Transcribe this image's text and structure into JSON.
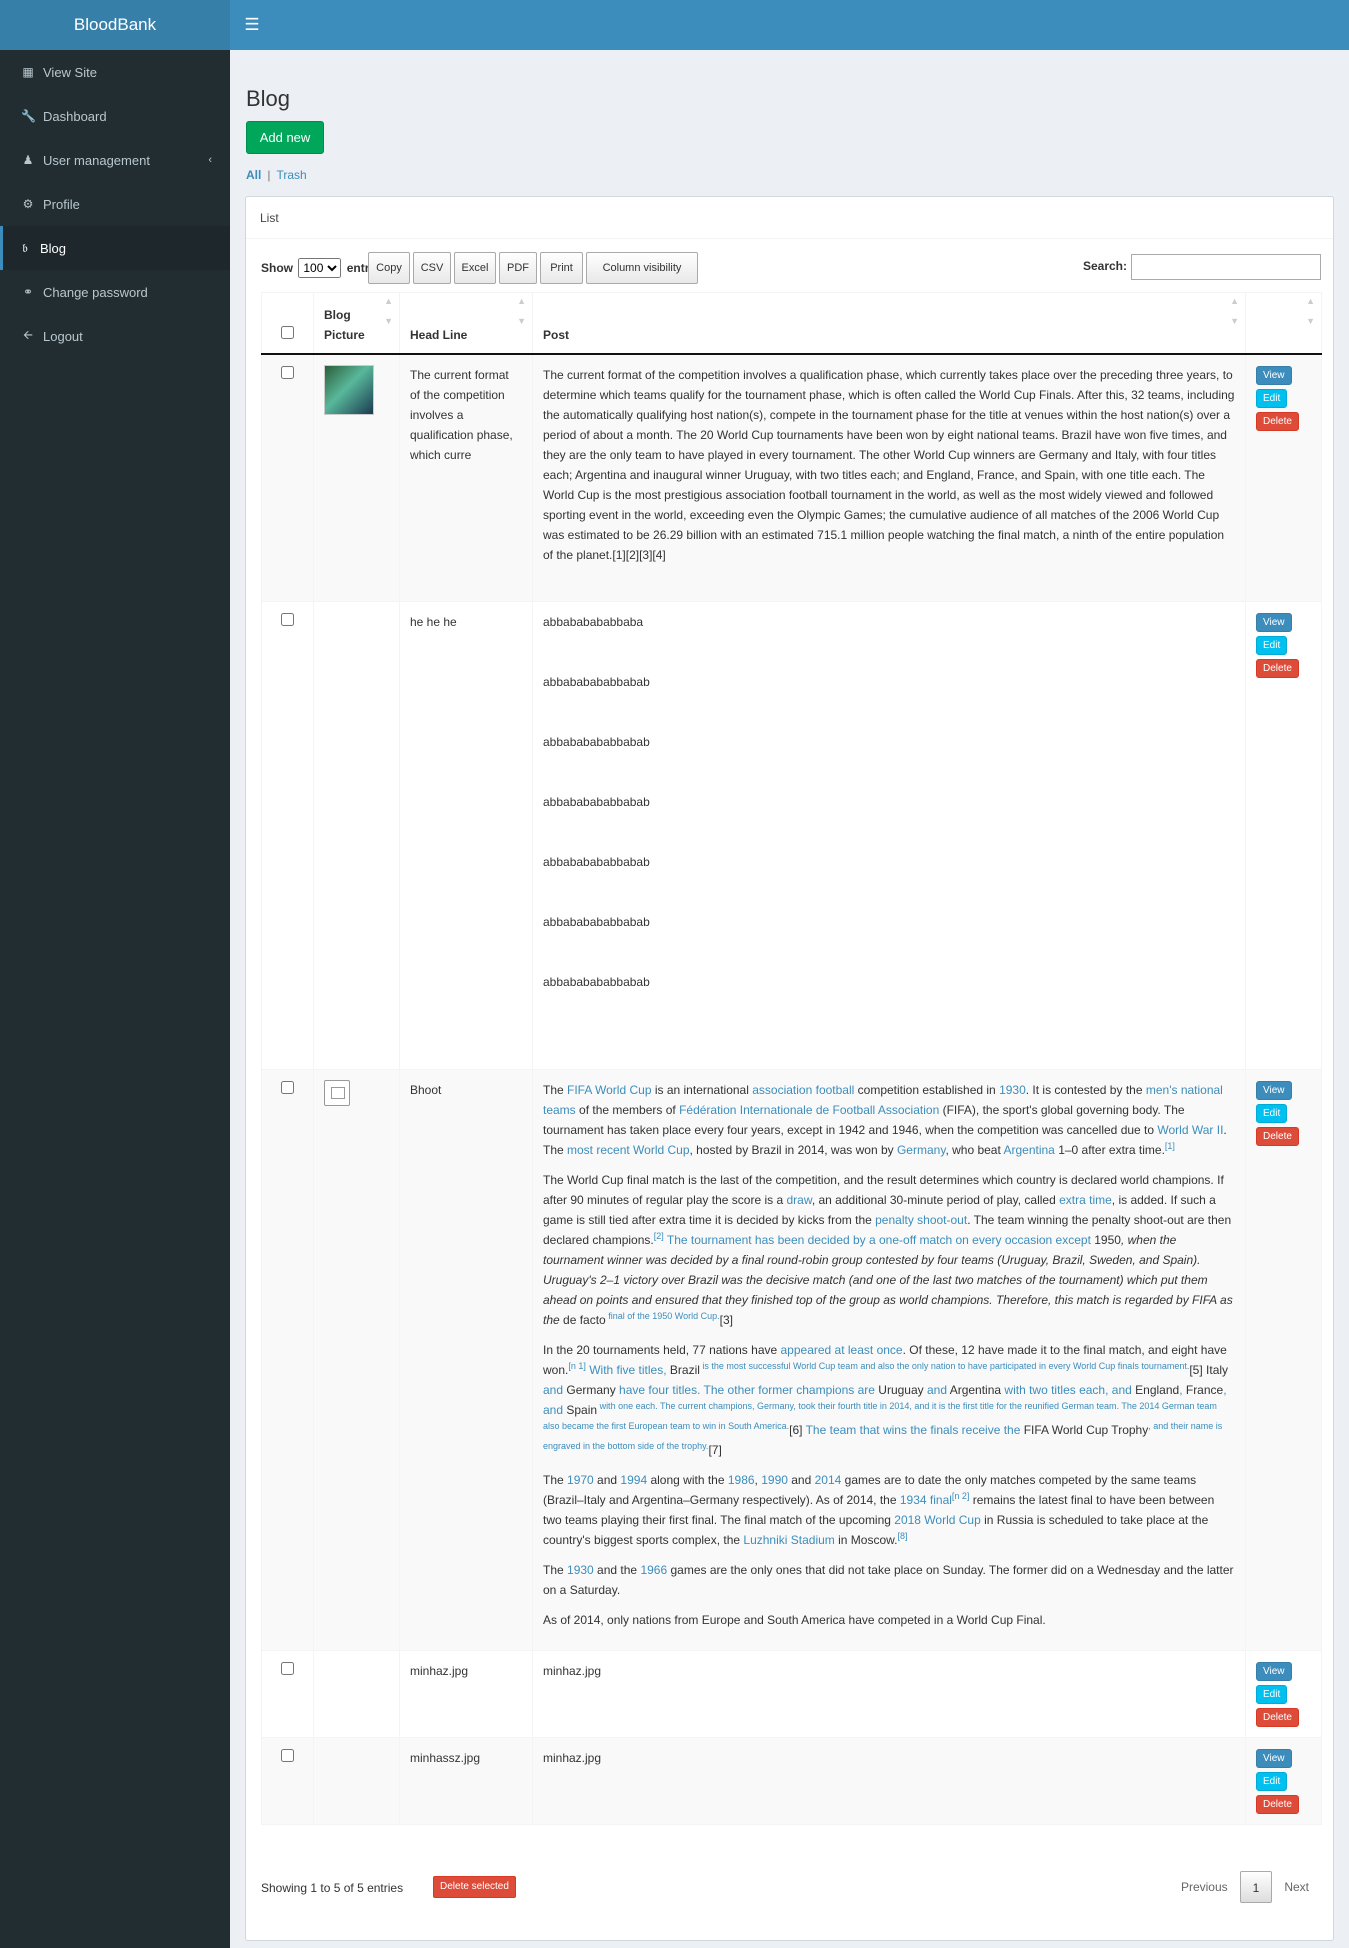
{
  "app": {
    "logo": "BloodBank",
    "toggle_icon": "bars-icon"
  },
  "sidebar": {
    "items": [
      {
        "label": "View Site",
        "icon": "th-icon"
      },
      {
        "label": "Dashboard",
        "icon": "wrench-icon"
      },
      {
        "label": "User management",
        "icon": "users-icon",
        "chevron": "chevron-left-icon"
      },
      {
        "label": "Profile",
        "icon": "cogs-icon"
      },
      {
        "label": "Blog",
        "icon": "text-icon",
        "active": true
      },
      {
        "label": "Change password",
        "icon": "key-icon"
      },
      {
        "label": "Logout",
        "icon": "arrow-left-icon"
      }
    ]
  },
  "page": {
    "title": "Blog",
    "add_button": "Add new",
    "filter_all": "All",
    "filter_sep": "|",
    "filter_trash": "Trash"
  },
  "box": {
    "title": "List"
  },
  "toolbar": {
    "show_label": "Show",
    "entries_value": "100",
    "entries_label": "entries",
    "buttons": [
      "Copy",
      "CSV",
      "Excel",
      "PDF",
      "Print",
      "Column visibility"
    ],
    "search_label": "Search:"
  },
  "table": {
    "headers": [
      "Blog Picture",
      "Head Line",
      "Post"
    ],
    "actions": {
      "view": "View",
      "edit": "Edit",
      "delete": "Delete"
    },
    "rows": [
      {
        "headline": "The current format of the competition involves a qualification phase, which curre",
        "post_plain": "The current format of the competition involves a qualification phase, which currently takes place over the preceding three years, to determine which teams qualify for the tournament phase, which is often called the World Cup Finals. After this, 32 teams, including the automatically qualifying host nation(s), compete in the tournament phase for the title at venues within the host nation(s) over a period of about a month. The 20 World Cup tournaments have been won by eight national teams. Brazil have won five times, and they are the only team to have played in every tournament. The other World Cup winners are Germany and Italy, with four titles each; Argentina and inaugural winner Uruguay, with two titles each; and England, France, and Spain, with one title each. The World Cup is the most prestigious association football tournament in the world, as well as the most widely viewed and followed sporting event in the world, exceeding even the Olympic Games; the cumulative audience of all matches of the 2006 World Cup was estimated to be 26.29 billion with an estimated 715.1 million people watching the final match, a ninth of the entire population of the planet.[1][2][3][4]"
      },
      {
        "headline": "he he he",
        "post_lines": [
          "abbababababbaba",
          "abbababababbabab",
          "abbababababbabab",
          "abbababababbabab",
          "abbababababbabab",
          "abbababababbabab",
          "abbababababbabab"
        ]
      },
      {
        "headline": "Bhoot",
        "p1": [
          "The ",
          "FIFA World Cup",
          " is an international ",
          "association football",
          " competition established in ",
          "1930",
          ". It is contested by the ",
          "men's national teams",
          " of the members of ",
          "Fédération Internationale de Football Association",
          " (FIFA), the sport's global governing body. The tournament has taken place every four years, except in 1942 and 1946, when the competition was cancelled due to ",
          "World War II",
          ". The ",
          "most recent World Cup",
          ", hosted by Brazil in 2014, was won by ",
          "Germany",
          ", who beat ",
          "Argentina",
          " 1–0 after extra time.",
          "[1]"
        ],
        "p2": [
          "The World Cup final match is the last of the competition, and the result determines which country is declared world champions. If after 90 minutes of regular play the score is a ",
          "draw",
          ", an additional 30-minute period of play, called ",
          "extra time",
          ", is added. If such a game is still tied after extra time it is decided by kicks from the ",
          "penalty shoot-out",
          ". The team winning the penalty shoot-out are then declared champions.",
          "[2]",
          " The tournament has been decided by a one-off match on every occasion except ",
          "1950",
          ", when the tournament winner was decided by a final round-robin group contested by four teams (Uruguay, Brazil, Sweden, and Spain). Uruguay's 2–1 victory over Brazil was the decisive match (and one of the last two matches of the tournament) which put them ahead on points and ensured that they finished top of the group as world champions. Therefore, this match is regarded by FIFA as the ",
          "de facto",
          " final of the 1950 World Cup.",
          "[3]"
        ],
        "p3": [
          "In the 20 tournaments held, 77 nations have ",
          "appeared at least once",
          ". Of these, 12 have made it to the final match, and eight have won.",
          "[n 1]",
          " With five titles, ",
          "Brazil",
          " is the most successful World Cup team and also the only nation to have participated in every World Cup finals tournament.",
          "[5]",
          " ",
          "Italy",
          " and ",
          "Germany",
          " have four titles. The other former champions are ",
          "Uruguay",
          " and ",
          "Argentina",
          " with two titles each, and ",
          "England",
          ", ",
          "France",
          ", and ",
          "Spain",
          " with one each. The current champions, Germany, took their fourth title in 2014, and it is the first title for the reunified German team. The 2014 German team also became the first European team to win in South America.",
          "[6]",
          " The team that wins the finals receive the ",
          "FIFA World Cup Trophy",
          ", and their name is engraved in the bottom side of the trophy.",
          "[7]"
        ],
        "p4": [
          "The ",
          "1970",
          " and ",
          "1994",
          " along with the ",
          "1986",
          ", ",
          "1990",
          " and ",
          "2014",
          " games are to date the only matches competed by the same teams (Brazil–Italy and Argentina–Germany respectively). As of 2014, the ",
          "1934 final",
          "[n 2]",
          " remains the latest final to have been between two teams playing their first final. The final match of the upcoming ",
          "2018 World Cup",
          " in Russia is scheduled to take place at the country's biggest sports complex, the ",
          "Luzhniki Stadium",
          " in Moscow.",
          "[8]"
        ],
        "p5": [
          "The ",
          "1930",
          " and the ",
          "1966",
          " games are the only ones that did not take place on Sunday. The former did on a Wednesday and the latter on a Saturday."
        ],
        "p6": "As of 2014, only nations from Europe and South America have competed in a World Cup Final."
      },
      {
        "headline": "minhaz.jpg",
        "post_plain": "minhaz.jpg"
      },
      {
        "headline": "minhassz.jpg",
        "post_plain": "minhaz.jpg"
      }
    ]
  },
  "footer": {
    "info": "Showing 1 to 5 of 5 entries",
    "delete_selected": "Delete selected",
    "prev": "Previous",
    "page": "1",
    "next": "Next"
  },
  "colors": {
    "header": "#3c8dbc",
    "logo_bg": "#367fa9",
    "sidebar": "#222d32",
    "add": "#00a65a",
    "view": "#3c8dbc",
    "edit": "#00c0ef",
    "delete": "#dd4b39"
  }
}
